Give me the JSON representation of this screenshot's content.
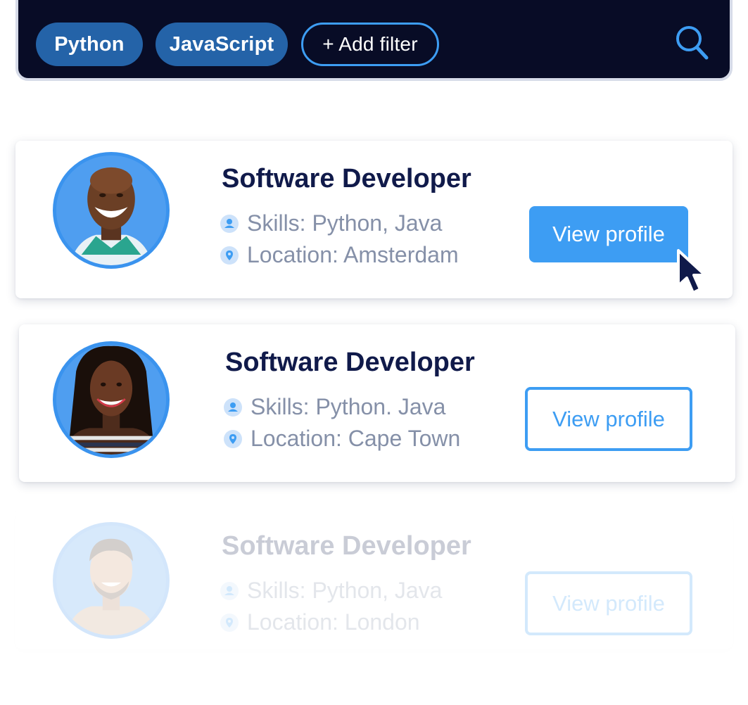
{
  "filters": {
    "chips": [
      "Python",
      "JavaScript"
    ],
    "add_label": "+ Add filter",
    "search_icon": "search-icon"
  },
  "results": [
    {
      "title": "Software Developer",
      "skills": "Skills: Python, Java",
      "location": "Location: Amsterdam",
      "button": "View profile",
      "button_style": "filled"
    },
    {
      "title": "Software Developer",
      "skills": "Skills: Python. Java",
      "location": "Location: Cape Town",
      "button": "View profile",
      "button_style": "outline"
    },
    {
      "title": "Software Developer",
      "skills": "Skills: Python, Java",
      "location": "Location: London",
      "button": "View profile",
      "button_style": "outline",
      "faded": true
    }
  ],
  "colors": {
    "bar_bg": "#080c26",
    "chip_bg": "#2463a8",
    "accent": "#3d9df3",
    "title": "#101a4a",
    "meta": "#8590a8"
  }
}
